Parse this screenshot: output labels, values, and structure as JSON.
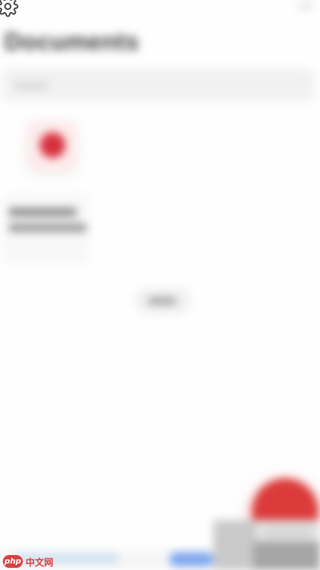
{
  "header": {
    "title": "Documents",
    "settings_icon": "gear-icon",
    "top_right_icon": "menu-icon"
  },
  "search": {
    "placeholder": "Search"
  },
  "main": {
    "tile_icon": "document-icon",
    "tile_color": "#d6303e"
  },
  "fab": {
    "icon": "add-icon",
    "color": "#dc3b3b"
  },
  "watermark": {
    "logo": "php",
    "text": "中文网"
  }
}
